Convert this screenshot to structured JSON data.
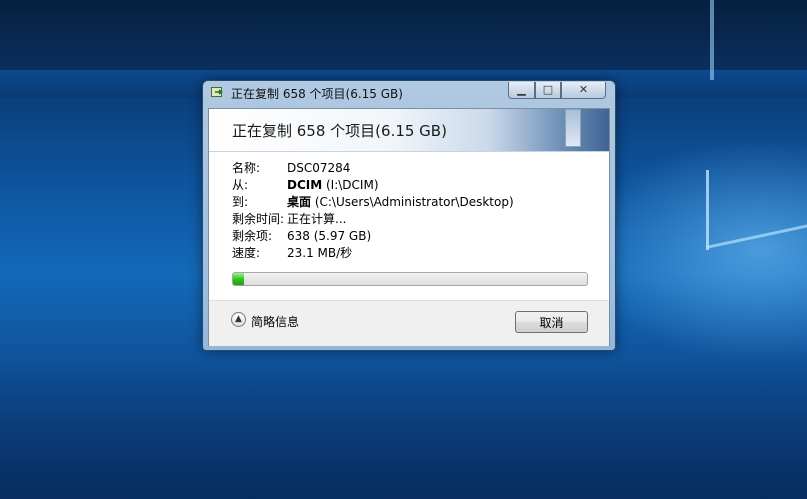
{
  "window": {
    "title": "正在复制 658 个项目(6.15 GB)",
    "controls": {
      "minimize": "▁",
      "maximize": "□",
      "close": "✕"
    }
  },
  "header": {
    "title": "正在复制 658 个项目(6.15 GB)"
  },
  "details": {
    "name": {
      "label": "名称:",
      "value": "DSC07284"
    },
    "from": {
      "label": "从:",
      "bold": "DCIM",
      "rest": " (I:\\DCIM)"
    },
    "to": {
      "label": "到:",
      "bold": "桌面",
      "rest": " (C:\\Users\\Administrator\\Desktop)"
    },
    "time_remaining": {
      "label": "剩余时间:",
      "value": "正在计算..."
    },
    "items_remaining": {
      "label": "剩余项:",
      "value": "638 (5.97 GB)"
    },
    "speed": {
      "label": "速度:",
      "value": "23.1 MB/秒"
    }
  },
  "progress": {
    "fraction": 0.03,
    "color": "#2fbe1f"
  },
  "footer": {
    "less_details_label": "简略信息",
    "cancel_label": "取消"
  }
}
